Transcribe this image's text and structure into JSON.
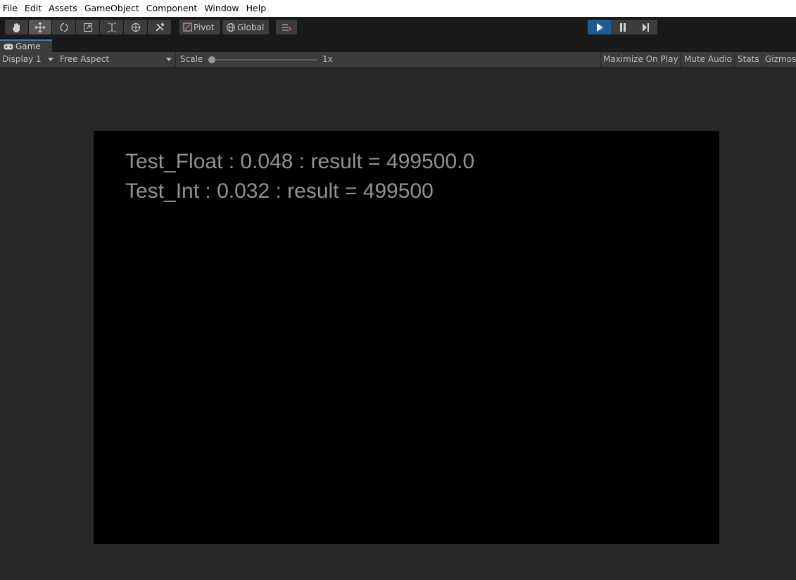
{
  "menu": [
    "File",
    "Edit",
    "Assets",
    "GameObject",
    "Component",
    "Window",
    "Help"
  ],
  "toolbar": {
    "tools": [
      "hand-tool-icon",
      "move-tool-icon",
      "rotate-tool-icon",
      "scale-tool-icon",
      "rect-tool-icon",
      "transform-tool-icon",
      "custom-tool-icon"
    ],
    "pivot_label": "Pivot",
    "global_label": "Global"
  },
  "tab": {
    "label": "Game"
  },
  "gamebar": {
    "display": "Display 1",
    "aspect": "Free Aspect",
    "scale_label": "Scale",
    "scale_value": "1x",
    "maximize": "Maximize On Play",
    "mute": "Mute Audio",
    "stats": "Stats",
    "gizmos": "Gizmos"
  },
  "game": {
    "line1": "Test_Float : 0.048 : result = 499500.0",
    "line2": "Test_Int : 0.032 : result = 499500"
  },
  "colors": {
    "play_active": "#1e5b91",
    "tab_accent": "#3a79bb",
    "game_text": "#929292"
  }
}
